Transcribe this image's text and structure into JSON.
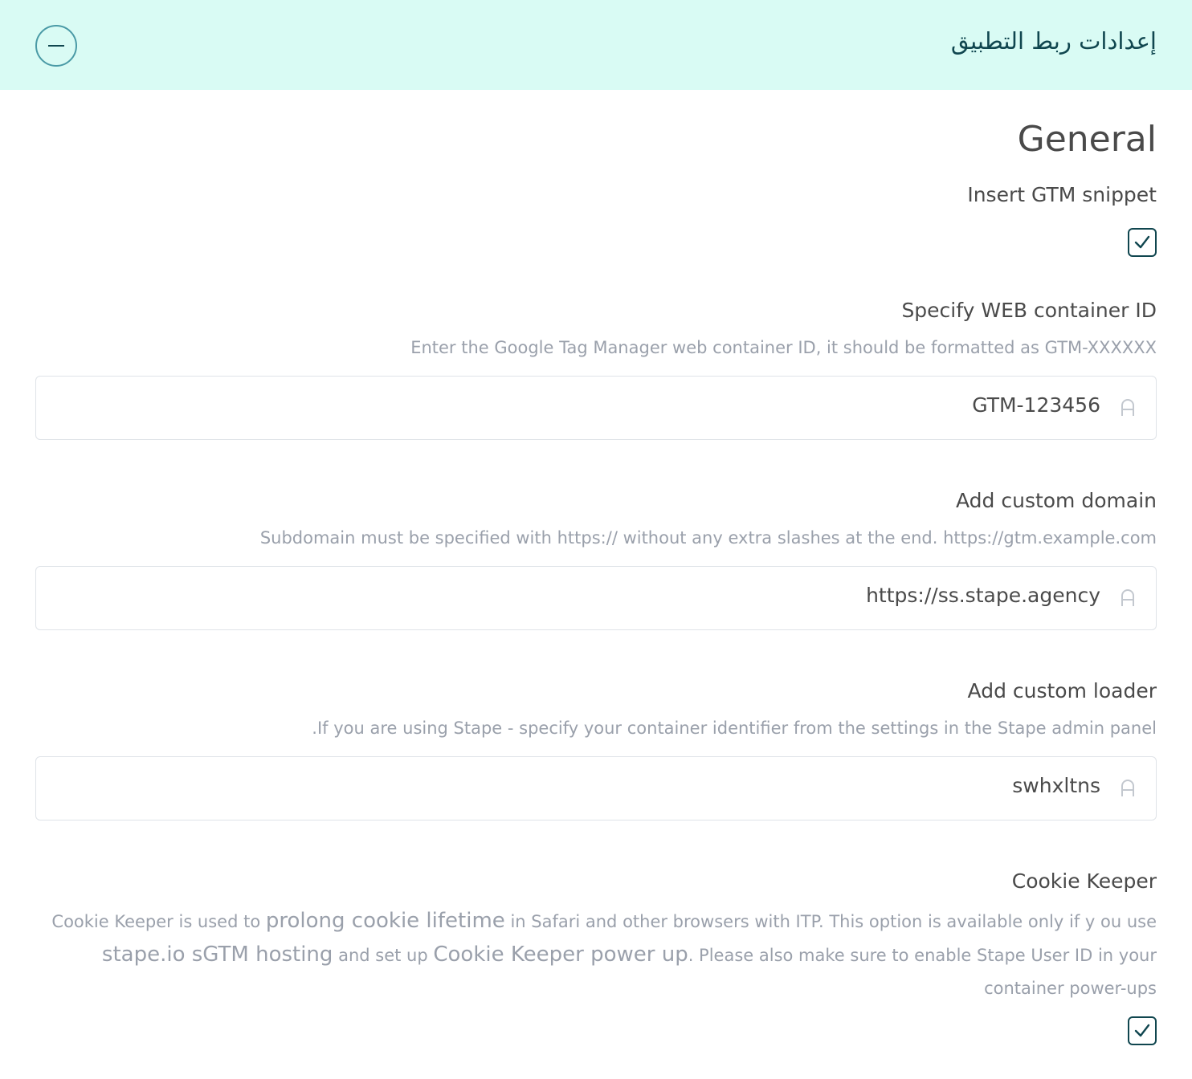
{
  "header": {
    "title": "إعدادات ربط التطبيق",
    "collapse_icon": "minus-circle-icon"
  },
  "colors": {
    "header_bg": "#d9fbf4",
    "accent": "#10464f",
    "hint_text": "#9aa0ab"
  },
  "general": {
    "title": "General",
    "insert_gtm": {
      "label": "Insert GTM snippet",
      "checked": true
    },
    "web_container": {
      "label": "Specify WEB container ID",
      "hint": "Enter the Google Tag Manager web container ID, it should be formatted as GTM-XXXXXX",
      "value": "GTM-123456",
      "icon": "text-input-icon"
    },
    "custom_domain": {
      "label": "Add custom domain",
      "hint": "Subdomain must be specified with https:// without any extra slashes at the end. https://gtm.example.com",
      "value": "https://ss.stape.agency",
      "icon": "text-input-icon"
    },
    "custom_loader": {
      "label": "Add custom loader",
      "hint": ".If you are using Stape - specify your container identifier from the settings in the Stape admin panel",
      "value": "swhxltns",
      "icon": "text-input-icon"
    },
    "cookie_keeper": {
      "label": "Cookie Keeper",
      "hint_parts": [
        "Cookie Keeper is used to ",
        "prolong cookie lifetime",
        " in Safari and other browsers with ITP. This option is available only if y ou use ",
        "stape.io sGTM hosting",
        " and set up ",
        "Cookie Keeper power up",
        ". Please also make sure to enable Stape User ID in your container power-ups"
      ],
      "checked": true
    }
  }
}
